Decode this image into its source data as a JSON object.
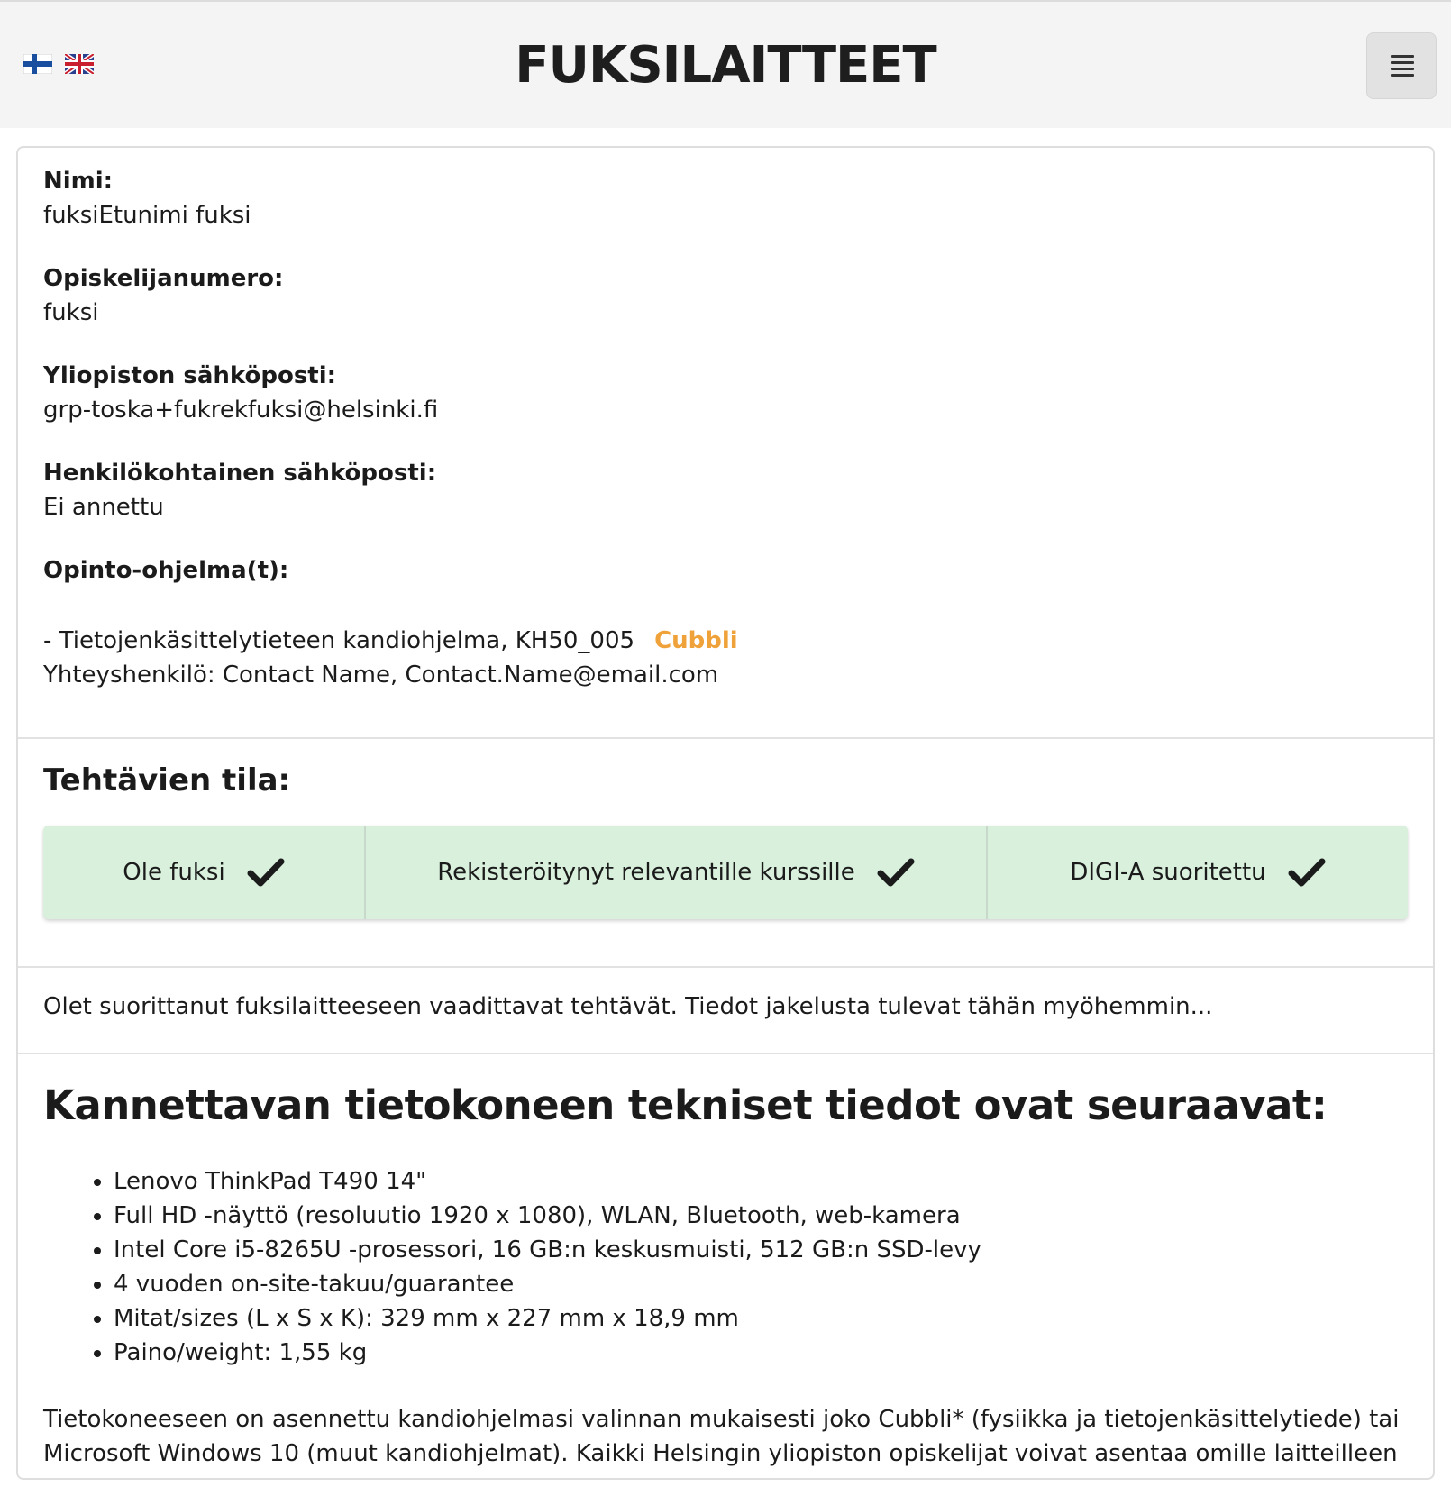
{
  "header": {
    "title": "FUKSILAITTEET",
    "flags": [
      "finnish-flag-icon",
      "uk-flag-icon"
    ],
    "menu_icon": "hamburger-menu-icon"
  },
  "profile": {
    "name_label": "Nimi:",
    "name_value": "fuksiEtunimi fuksi",
    "student_number_label": "Opiskelijanumero:",
    "student_number_value": "fuksi",
    "university_email_label": "Yliopiston sähköposti:",
    "university_email_value": "grp-toska+fukrekfuksi@helsinki.fi",
    "personal_email_label": "Henkilökohtainen sähköposti:",
    "personal_email_value": "Ei annettu",
    "programs_label": "Opinto-ohjelma(t):",
    "program_line": "- Tietojenkäsittelytieteen kandiohjelma, KH50_005",
    "program_os": "Cubbli",
    "contact_line": "Yhteyshenkilö: Contact Name, Contact.Name@email.com"
  },
  "status": {
    "title": "Tehtävien tila:",
    "items": [
      {
        "label": "Ole fuksi",
        "done": true
      },
      {
        "label": "Rekisteröitynyt relevantille kurssille",
        "done": true
      },
      {
        "label": "DIGI-A suoritettu",
        "done": true
      }
    ]
  },
  "message": "Olet suorittanut fuksilaitteeseen vaadittavat tehtävät. Tiedot jakelusta tulevat tähän myöhemmin...",
  "specs": {
    "heading": "Kannettavan tietokoneen tekniset tiedot ovat seuraavat:",
    "items": [
      "Lenovo ThinkPad T490 14\"",
      "Full HD -näyttö (resoluutio 1920 x 1080), WLAN, Bluetooth, web-kamera",
      "Intel Core i5-8265U -prosessori, 16 GB:n keskusmuisti, 512 GB:n SSD-levy",
      "4 vuoden on-site-takuu/guarantee",
      "Mitat/sizes (L x S x K): 329 mm x 227 mm x 18,9 mm",
      "Paino/weight: 1,55 kg"
    ],
    "note": "Tietokoneeseen on asennettu kandiohjelmasi valinnan mukaisesti joko Cubbli* (fysiikka ja tietojenkäsittelytiede) tai Microsoft Windows 10 (muut kandiohjelmat). Kaikki Helsingin yliopiston opiskelijat voivat asentaa omille laitteilleen"
  },
  "colors": {
    "status_bg": "#d8f0dc",
    "os_link": "#f0a23a"
  }
}
